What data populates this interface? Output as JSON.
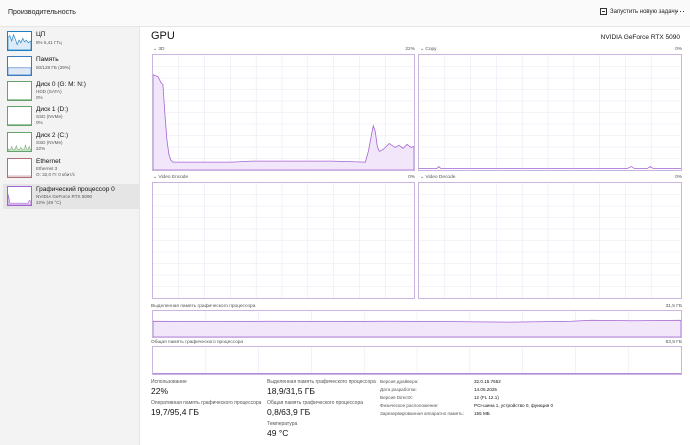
{
  "app": {
    "title": "Производительность"
  },
  "header": {
    "run_task": "Запустить новую задачу",
    "more": "⋯"
  },
  "sidebar": {
    "items": [
      {
        "name": "ЦП",
        "sub1": "8% 5,41 ГГц",
        "sub2": "",
        "level": 0.08
      },
      {
        "name": "Память",
        "sub1": "50/128 ГБ (39%)",
        "sub2": "",
        "level": 0.39
      },
      {
        "name": "Диск 0 (G: M: N:)",
        "sub1": "HDD (SATA)",
        "sub2": "0%",
        "level": 0
      },
      {
        "name": "Диск 1 (D:)",
        "sub1": "SSD (NVMe)",
        "sub2": "0%",
        "level": 0
      },
      {
        "name": "Диск 2 (C:)",
        "sub1": "SSD (NVMe)",
        "sub2": "22%",
        "level": 0.22
      },
      {
        "name": "Ethernet",
        "sub1": "Ethernet 3",
        "sub2": "О: 32,0 П: 0 кбит/с",
        "level": 0
      },
      {
        "name": "Графический процессор 0",
        "sub1": "NVIDIA GeForce RTX 5090",
        "sub2": "22% (49 °C)",
        "level": 0.22
      }
    ]
  },
  "main": {
    "title": "GPU",
    "model": "NVIDIA GeForce RTX 5090",
    "engines": [
      {
        "label": "3D",
        "percent": "22%"
      },
      {
        "label": "Copy",
        "percent": "0%"
      },
      {
        "label": "Video Encode",
        "percent": "0%"
      },
      {
        "label": "Video Decode",
        "percent": "0%"
      }
    ],
    "dedicated_mem": {
      "label": "Выделенная память графического процессора",
      "value": "31,5 ГБ"
    },
    "shared_mem": {
      "label": "Общая память графического процессора",
      "value": "63,9 ГБ"
    }
  },
  "stats": {
    "utilization": {
      "label": "Использование",
      "value": "22%"
    },
    "dedicated": {
      "label": "Выделенная память графического процессора",
      "value": "18,9/31,5 ГБ"
    },
    "ram": {
      "label": "Оперативная память графического процессора",
      "value": "19,7/95,4 ГБ"
    },
    "shared": {
      "label": "Общая память графического процессора",
      "value": "0,8/63,9 ГБ"
    },
    "temp": {
      "label": "Температура",
      "value": "49 °C"
    }
  },
  "properties": [
    {
      "key": "Версия драйвера:",
      "value": "32.0.15.7652"
    },
    {
      "key": "Дата разработки:",
      "value": "14.05.2025"
    },
    {
      "key": "Версия DirectX:",
      "value": "12 (FL 12.1)"
    },
    {
      "key": "Физическое расположение:",
      "value": "PCI-шина 1, устройство 0, функция 0"
    },
    {
      "key": "Зарезервированная аппаратно память:",
      "value": "155 МБ"
    }
  ],
  "colors": {
    "accent": "#a463d3",
    "fill": "#f1e6fa",
    "grid": "#eee6f5",
    "border": "#c9b5df"
  },
  "icons": {
    "run_task": "new-task-icon",
    "more": "more-icon"
  }
}
